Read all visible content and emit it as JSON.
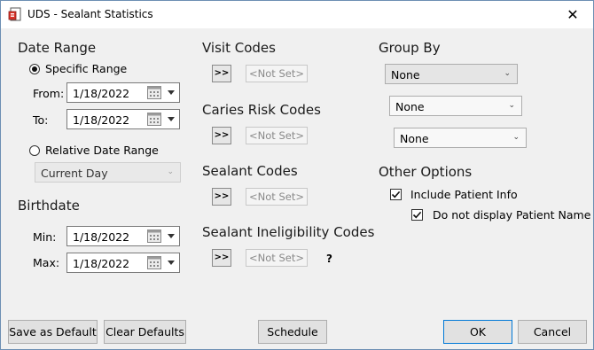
{
  "window": {
    "title": "UDS - Sealant Statistics",
    "close_glyph": "✕",
    "app_icon": "report-icon"
  },
  "date_range": {
    "heading": "Date Range",
    "specific_label": "Specific Range",
    "from_label": "From:",
    "from_value": "1/18/2022",
    "to_label": "To:",
    "to_value": "1/18/2022",
    "relative_label": "Relative Date Range",
    "relative_value": "Current Day",
    "selected": "specific"
  },
  "birthdate": {
    "heading": "Birthdate",
    "min_label": "Min:",
    "min_value": "1/18/2022",
    "max_label": "Max:",
    "max_value": "1/18/2022"
  },
  "codes": {
    "picker_label": ">>",
    "visit": {
      "heading": "Visit Codes",
      "value": "<Not Set>"
    },
    "caries": {
      "heading": "Caries Risk Codes",
      "value": "<Not Set>"
    },
    "sealant": {
      "heading": "Sealant Codes",
      "value": "<Not Set>"
    },
    "ineligibility": {
      "heading": "Sealant Ineligibility Codes",
      "value": "<Not Set>",
      "help": "?"
    }
  },
  "group_by": {
    "heading": "Group By",
    "values": [
      "None",
      "None",
      "None"
    ]
  },
  "other_options": {
    "heading": "Other Options",
    "include_patient_info": {
      "label": "Include Patient Info",
      "checked": true
    },
    "hide_patient_name": {
      "label": "Do not display Patient Name",
      "checked": true
    }
  },
  "buttons": {
    "save_default": "Save as Default",
    "clear_defaults": "Clear Defaults",
    "schedule": "Schedule",
    "ok": "OK",
    "cancel": "Cancel"
  },
  "colors": {
    "focus_border": "#0078d7",
    "dialog_bg": "#f0f0f0"
  }
}
